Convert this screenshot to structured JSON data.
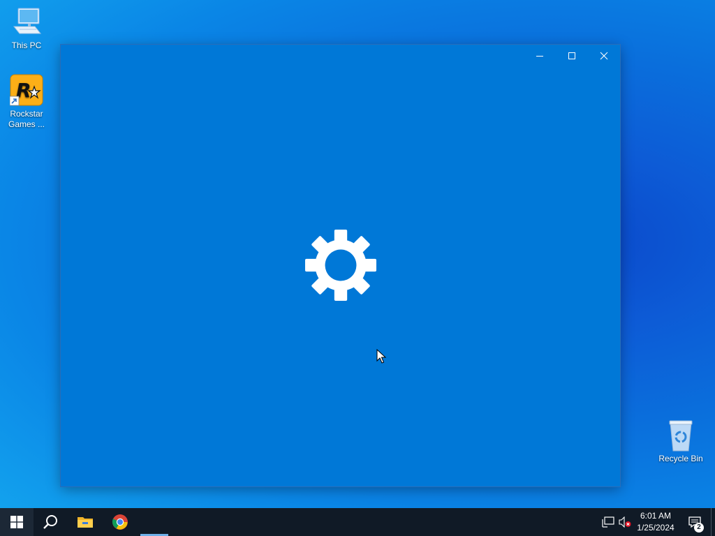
{
  "desktop": {
    "icons": [
      {
        "label": "This PC"
      },
      {
        "label": "Rockstar Games ..."
      },
      {
        "label": "Recycle Bin"
      }
    ]
  },
  "window": {
    "content_icon": "gear-icon",
    "buttons": {
      "minimize": "minimize-icon",
      "maximize": "maximize-icon",
      "close": "close-icon"
    },
    "background": "#0078d7"
  },
  "taskbar": {
    "pinned": [
      "start-icon",
      "search-icon",
      "file-explorer-icon",
      "chrome-icon"
    ],
    "clock": {
      "time": "6:01 AM",
      "date": "1/25/2024"
    },
    "notifications_count": "2",
    "tray_icons": [
      "network-icon",
      "volume-muted-icon",
      "action-center-icon"
    ]
  },
  "colors": {
    "accent": "#0078d7",
    "taskbar": "#101a26",
    "mute_badge": "#e81123"
  }
}
